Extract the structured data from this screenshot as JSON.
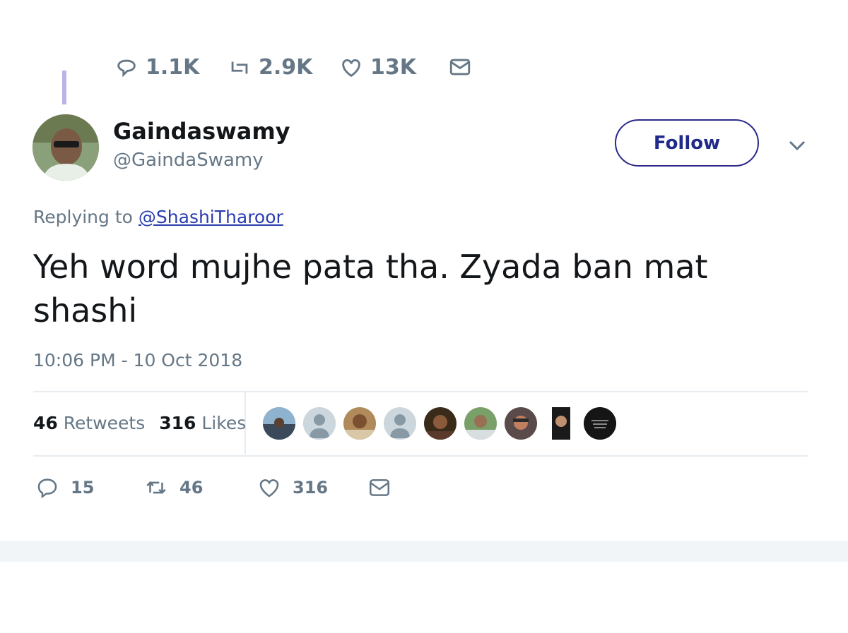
{
  "previous_tweet": {
    "reply_count": "1.1K",
    "retweet_count": "2.9K",
    "like_count": "13K"
  },
  "tweet": {
    "display_name": "Gaindaswamy",
    "handle": "@GaindaSwamy",
    "follow_label": "Follow",
    "replying_prefix": "Replying to",
    "replying_to": "@ShashiTharoor",
    "text": "Yeh word mujhe pata tha. Zyada ban mat shashi",
    "timestamp": "10:06 PM - 10 Oct 2018",
    "retweets_count": "46",
    "retweets_label": "Retweets",
    "likes_count": "316",
    "likes_label": "Likes",
    "reply_action_count": "15",
    "retweet_action_count": "46",
    "like_action_count": "316"
  },
  "colors": {
    "text": "#14171a",
    "muted": "#657786",
    "link": "#2b3db0",
    "follow_border": "#2b2a8a",
    "divider": "#e6ecf0",
    "thread_line": "#b9b3e8"
  },
  "icons": [
    "reply-icon",
    "retweet-icon",
    "heart-icon",
    "message-icon",
    "chevron-down-icon"
  ]
}
